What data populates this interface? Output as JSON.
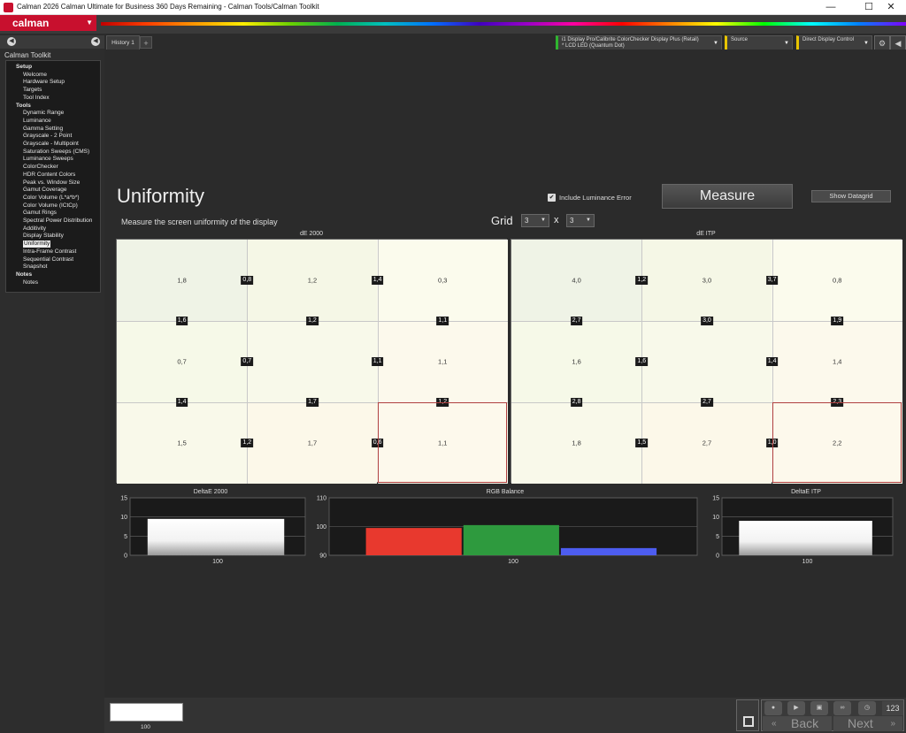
{
  "window": {
    "title": "Calman 2026 Calman Ultimate for Business 360 Days Remaining  - Calman Tools/Calman Toolkit",
    "minimize": "—",
    "maximize": "☐",
    "close": "✕"
  },
  "brand": {
    "name": "calman"
  },
  "sidebar": {
    "title": "Calman Toolkit",
    "items": [
      {
        "label": "Setup",
        "group": true
      },
      {
        "label": "Welcome"
      },
      {
        "label": "Hardware Setup"
      },
      {
        "label": "Targets"
      },
      {
        "label": "Tool Index"
      },
      {
        "label": "Tools",
        "group": true
      },
      {
        "label": "Dynamic Range"
      },
      {
        "label": "Luminance"
      },
      {
        "label": "Gamma Setting"
      },
      {
        "label": "Grayscale - 2 Point"
      },
      {
        "label": "Grayscale - Multipoint"
      },
      {
        "label": "Saturation Sweeps (CMS)"
      },
      {
        "label": "Luminance Sweeps"
      },
      {
        "label": "ColorChecker"
      },
      {
        "label": "HDR Content Colors"
      },
      {
        "label": "Peak vs. Window Size"
      },
      {
        "label": "Gamut Coverage"
      },
      {
        "label": "Color Volume (L*a*b*)"
      },
      {
        "label": "Color Volume (ICtCp)"
      },
      {
        "label": "Gamut Rings"
      },
      {
        "label": "Spectral Power Distribution"
      },
      {
        "label": "Additivity"
      },
      {
        "label": "Display Stability"
      },
      {
        "label": "Uniformity",
        "selected": true
      },
      {
        "label": "Intra-Frame Contrast"
      },
      {
        "label": "Sequential Contrast"
      },
      {
        "label": "Snapshot"
      },
      {
        "label": "Notes",
        "group": true
      },
      {
        "label": "Notes"
      }
    ]
  },
  "tabs": {
    "history": "History 1",
    "plus": "+"
  },
  "devices": {
    "meter_line1": "i1 Display Pro/Calibrite ColorChecker Display Plus (Retail)",
    "meter_line2": "* LCD LED (Quantum Dot)",
    "source": "Source",
    "display": "Direct Display Control"
  },
  "page": {
    "title": "Uniformity",
    "subtitle": "Measure the screen uniformity of the display",
    "include_lum_label": "Include Luminance Error",
    "measure_label": "Measure",
    "show_datagrid_label": "Show Datagrid",
    "grid_label": "Grid",
    "grid_x": "3",
    "grid_y": "3",
    "x_label": "x"
  },
  "panels": [
    {
      "title": "dE 2000",
      "cells": [
        "1,8",
        "1,2",
        "0,3",
        "0,7",
        "",
        "1,1",
        "1,5",
        "1,7",
        "1,1"
      ],
      "badges_v": [
        "0,8",
        "1,4",
        "0,7",
        "1,1",
        "1,2",
        "0,6"
      ],
      "badges_h": [
        "1,6",
        "1,2",
        "1,1",
        "1,4",
        "1,7",
        "1,2"
      ]
    },
    {
      "title": "dE ITP",
      "cells": [
        "4,0",
        "3,0",
        "0,8",
        "1,6",
        "",
        "1,4",
        "1,8",
        "2,7",
        "2,2"
      ],
      "badges_v": [
        "1,2",
        "3,7",
        "1,6",
        "1,4",
        "1,5",
        "1,0"
      ],
      "badges_h": [
        "2,7",
        "3,0",
        "1,9",
        "2,8",
        "2,7",
        "2,3"
      ]
    }
  ],
  "chart_data": [
    {
      "type": "bar",
      "title": "DeltaE 2000",
      "categories": [
        "100"
      ],
      "values": [
        9.5
      ],
      "ylim": [
        0,
        15
      ],
      "yticks": [
        "15",
        "10",
        "5",
        "0"
      ],
      "xlabel": "100"
    },
    {
      "type": "bar",
      "title": "RGB Balance",
      "categories": [
        "100"
      ],
      "series": [
        {
          "name": "R",
          "values": [
            99.5
          ]
        },
        {
          "name": "G",
          "values": [
            100.5
          ]
        },
        {
          "name": "B",
          "values": [
            92.5
          ]
        }
      ],
      "ylim": [
        90,
        110
      ],
      "yticks": [
        "110",
        "100",
        "90"
      ],
      "xlabel": "100",
      "colors": [
        "#e8392e",
        "#2e9a3e",
        "#4d5df0"
      ]
    },
    {
      "type": "bar",
      "title": "DeltaE ITP",
      "categories": [
        "100"
      ],
      "values": [
        9
      ],
      "ylim": [
        0,
        15
      ],
      "yticks": [
        "15",
        "10",
        "5",
        "0"
      ],
      "xlabel": "100"
    }
  ],
  "bottom": {
    "thumb_label": "100",
    "back": "Back",
    "next": "Next",
    "count": "123"
  }
}
